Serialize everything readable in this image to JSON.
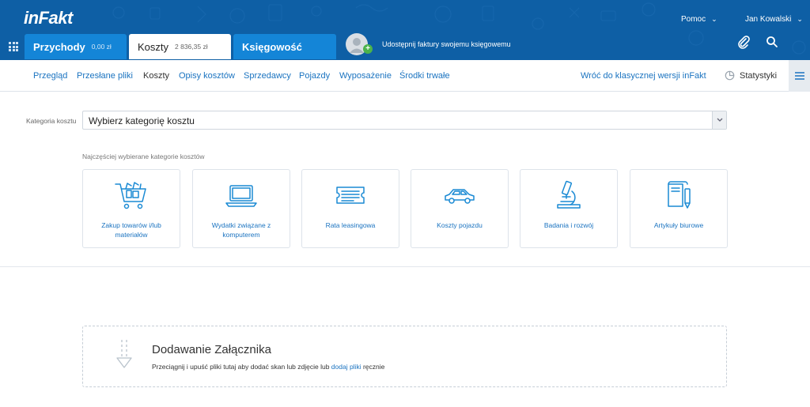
{
  "brand": {
    "logo": "inFakt"
  },
  "top": {
    "help_label": "Pomoc",
    "user_name": "Jan Kowalski",
    "share_text": "Udostępnij faktury swojemu księgowemu",
    "icons": [
      "apps-grid-icon",
      "avatar-add-icon",
      "paperclip-icon",
      "search-icon",
      "chevron-down-icon"
    ]
  },
  "tabs": [
    {
      "label": "Przychody",
      "amount": "0,00 zł",
      "active": false
    },
    {
      "label": "Koszty",
      "amount": "2 836,35 zł",
      "active": true
    },
    {
      "label": "Księgowość",
      "amount": "",
      "active": false
    }
  ],
  "subnav": {
    "items": [
      "Przegląd",
      "Przesłane pliki",
      "Koszty",
      "Opisy kosztów",
      "Sprzedawcy",
      "Pojazdy",
      "Wyposażenie",
      "Środki trwałe"
    ],
    "active_item": "Koszty",
    "back_link": "Wróć do klasycznej wersji inFakt",
    "stats_label": "Statystyki"
  },
  "category": {
    "label": "Kategoria kosztu",
    "select_value": "Wybierz kategorię kosztu",
    "frequent_label": "Najczęściej wybierane kategorie kosztów",
    "cards": [
      {
        "label": "Zakup towarów i/lub materiałów",
        "icon": "shopping-cart-icon"
      },
      {
        "label": "Wydatki związane z komputerem",
        "icon": "laptop-icon"
      },
      {
        "label": "Rata leasingowa",
        "icon": "document-icon"
      },
      {
        "label": "Koszty pojazdu",
        "icon": "car-icon"
      },
      {
        "label": "Badania i rozwój",
        "icon": "microscope-icon"
      },
      {
        "label": "Artykuły biurowe",
        "icon": "office-supplies-icon"
      }
    ]
  },
  "attachment": {
    "title": "Dodawanie Załącznika",
    "desc_before": "Przeciągnij i upuść pliki tutaj aby dodać skan lub zdjęcie lub ",
    "desc_link": "dodaj pliki",
    "desc_after": " ręcznie"
  },
  "colors": {
    "topbar": "#0e5fa5",
    "tab": "#1485d7",
    "link": "#1a73c0",
    "icon": "#1a8ad4"
  }
}
